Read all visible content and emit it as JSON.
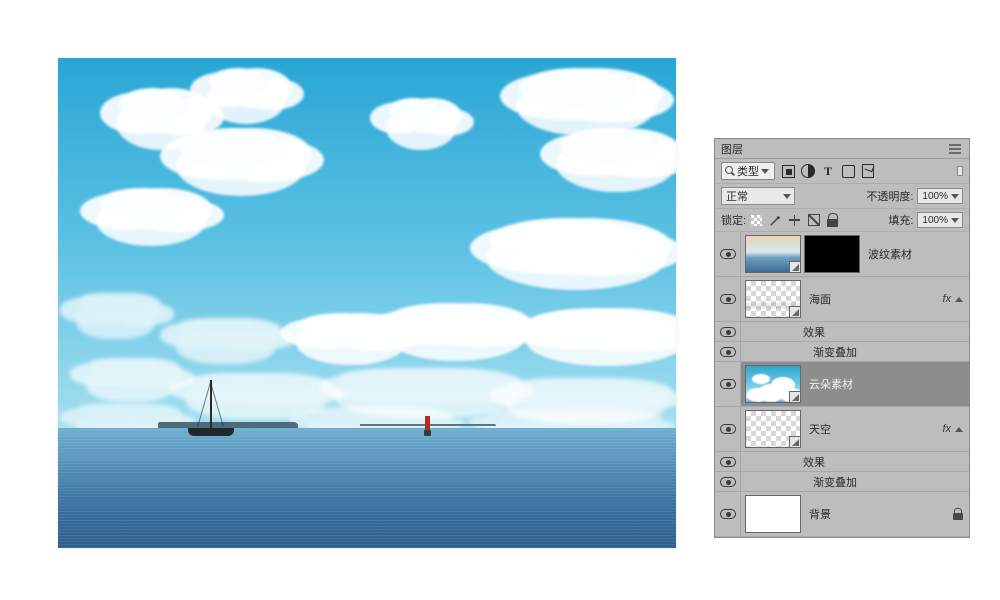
{
  "panel": {
    "title": "图层",
    "search_label": "类型",
    "blend_mode": "正常",
    "opacity_label": "不透明度:",
    "opacity_value": "100%",
    "lock_label": "锁定:",
    "fill_label": "填充:",
    "fill_value": "100%",
    "fx_label": "fx",
    "effects_label": "效果",
    "gradient_overlay_label": "渐变叠加"
  },
  "layers": [
    {
      "name": "波纹素材",
      "visible": true,
      "has_mask": true,
      "selected": false,
      "thumb": "ripple",
      "has_fx": false,
      "locked": false
    },
    {
      "name": "海面",
      "visible": true,
      "has_mask": false,
      "selected": false,
      "thumb": "checker-sea",
      "has_fx": true,
      "locked": false
    },
    {
      "name": "云朵素材",
      "visible": true,
      "has_mask": false,
      "selected": true,
      "thumb": "clouds",
      "has_fx": false,
      "locked": false
    },
    {
      "name": "天空",
      "visible": true,
      "has_mask": false,
      "selected": false,
      "thumb": "checker",
      "has_fx": true,
      "locked": false
    },
    {
      "name": "背景",
      "visible": true,
      "has_mask": false,
      "selected": false,
      "thumb": "white",
      "has_fx": false,
      "locked": true
    }
  ],
  "filter_icons": {
    "pixel": "pixel-layer-filter-icon",
    "adjust": "adjustment-layer-filter-icon",
    "text": "T",
    "shape": "shape-layer-filter-icon",
    "smart": "smart-object-filter-icon",
    "film": "artboard-filter-icon"
  }
}
